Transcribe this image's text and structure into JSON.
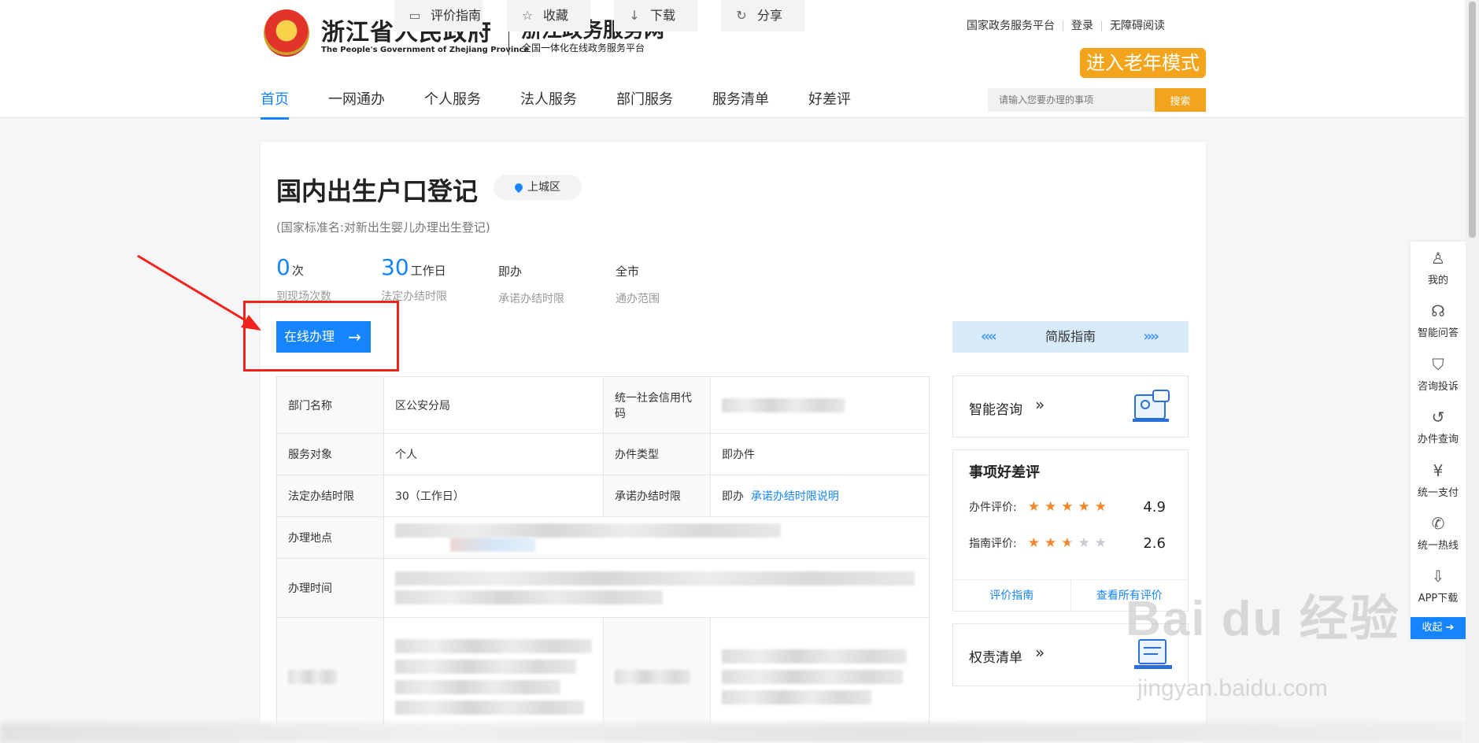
{
  "header": {
    "gov_name": "浙江省人民政府",
    "gov_en": "The People's Government of Zhejiang Province",
    "site_name": "浙江政务服务网",
    "site_sub": "全国一体化在线政务服务平台",
    "top_links": [
      "国家政务服务平台",
      "登录",
      "无障碍阅读"
    ],
    "elder_mode": "进入老年模式",
    "nav": [
      "首页",
      "一网通办",
      "个人服务",
      "法人服务",
      "部门服务",
      "服务清单",
      "好差评"
    ],
    "search_placeholder": "请输入您要办理的事项",
    "search_button": "搜索"
  },
  "item": {
    "title": "国内出生户口登记",
    "location": "上城区",
    "standard_name": "(国家标准名:对新出生婴儿办理出生登记)",
    "stats": [
      {
        "value": "0",
        "unit": "次",
        "label": "到现场次数",
        "highlight": true
      },
      {
        "value": "30",
        "unit": "工作日",
        "label": "法定办结时限",
        "highlight": true
      },
      {
        "value": "即办",
        "unit": "",
        "label": "承诺办结时限",
        "highlight": false
      },
      {
        "value": "全市",
        "unit": "",
        "label": "通办范围",
        "highlight": false
      }
    ],
    "actions": {
      "online": "在线办理",
      "evaluate": "评价指南",
      "favorite": "收藏",
      "download": "下载",
      "share": "分享",
      "simple_guide": "简版指南"
    }
  },
  "info_table": {
    "dept_label": "部门名称",
    "dept_value": "区公安分局",
    "credit_label": "统一社会信用代码",
    "target_label": "服务对象",
    "target_value": "个人",
    "type_label": "办件类型",
    "type_value": "即办件",
    "legal_label": "法定办结时限",
    "legal_value": "30（工作日）",
    "promise_label": "承诺办结时限",
    "promise_value": "即办",
    "promise_link": "承诺办结时限说明",
    "place_label": "办理地点",
    "time_label": "办理时间"
  },
  "right_panels": {
    "smart": "智能咨询",
    "rating_title": "事项好差评",
    "rating_rows": [
      {
        "label": "办件评价:",
        "score": "4.9",
        "stars": 5
      },
      {
        "label": "指南评价:",
        "score": "2.6",
        "stars": 2.5
      }
    ],
    "rating_links": [
      "评价指南",
      "查看所有评价"
    ],
    "power_list": "权责清单",
    "chevrons": "»"
  },
  "sidebar": {
    "items": [
      {
        "label": "我的",
        "icon": "user-icon"
      },
      {
        "label": "智能问答",
        "icon": "headset-icon"
      },
      {
        "label": "咨询投诉",
        "icon": "shield-icon"
      },
      {
        "label": "办件查询",
        "icon": "history-icon"
      },
      {
        "label": "统一支付",
        "icon": "yuan-icon"
      },
      {
        "label": "统一热线",
        "icon": "phone-icon"
      },
      {
        "label": "APP下载",
        "icon": "download-icon"
      }
    ],
    "collapse": "收起"
  },
  "watermark": {
    "main": "Bai du 经验",
    "sub": "jingyan.baidu.com"
  },
  "colors": {
    "accent": "#1684fc",
    "orange": "#f2a41c",
    "annotation_red": "#f0231d"
  }
}
